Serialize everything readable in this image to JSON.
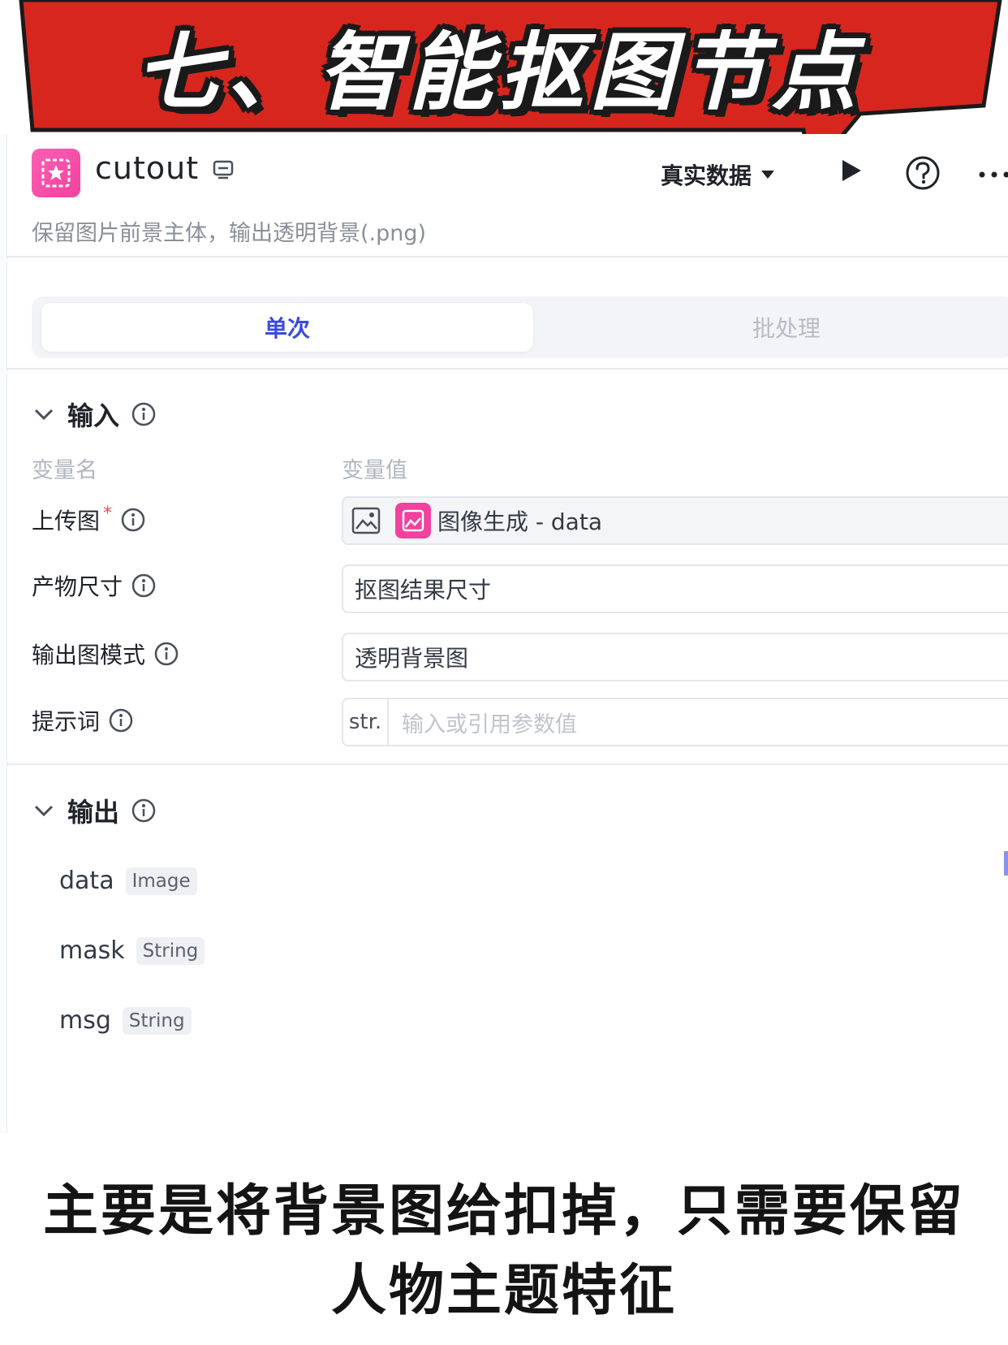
{
  "banner": {
    "title": "七、智能抠图节点",
    "bg_color": "#d7261e"
  },
  "node": {
    "name": "cutout",
    "description": "保留图片前景主体，输出透明背景(.png)",
    "data_source": "真实数据"
  },
  "tabs": {
    "single": "单次",
    "batch": "批处理"
  },
  "input_section": {
    "title": "输入",
    "col_name": "变量名",
    "col_value": "变量值",
    "rows": [
      {
        "label": "上传图",
        "required_mark": "*",
        "ref_text": "图像生成 - data"
      },
      {
        "label": "产物尺寸",
        "value": "抠图结果尺寸"
      },
      {
        "label": "输出图模式",
        "value": "透明背景图"
      },
      {
        "label": "提示词",
        "type_tag": "str.",
        "placeholder": "输入或引用参数值"
      }
    ]
  },
  "output_section": {
    "title": "输出",
    "items": [
      {
        "name": "data",
        "type": "Image"
      },
      {
        "name": "mask",
        "type": "String"
      },
      {
        "name": "msg",
        "type": "String"
      }
    ]
  },
  "caption": {
    "line1": "主要是将背景图给扣掉，只需要保留",
    "line2": "人物主题特征"
  }
}
